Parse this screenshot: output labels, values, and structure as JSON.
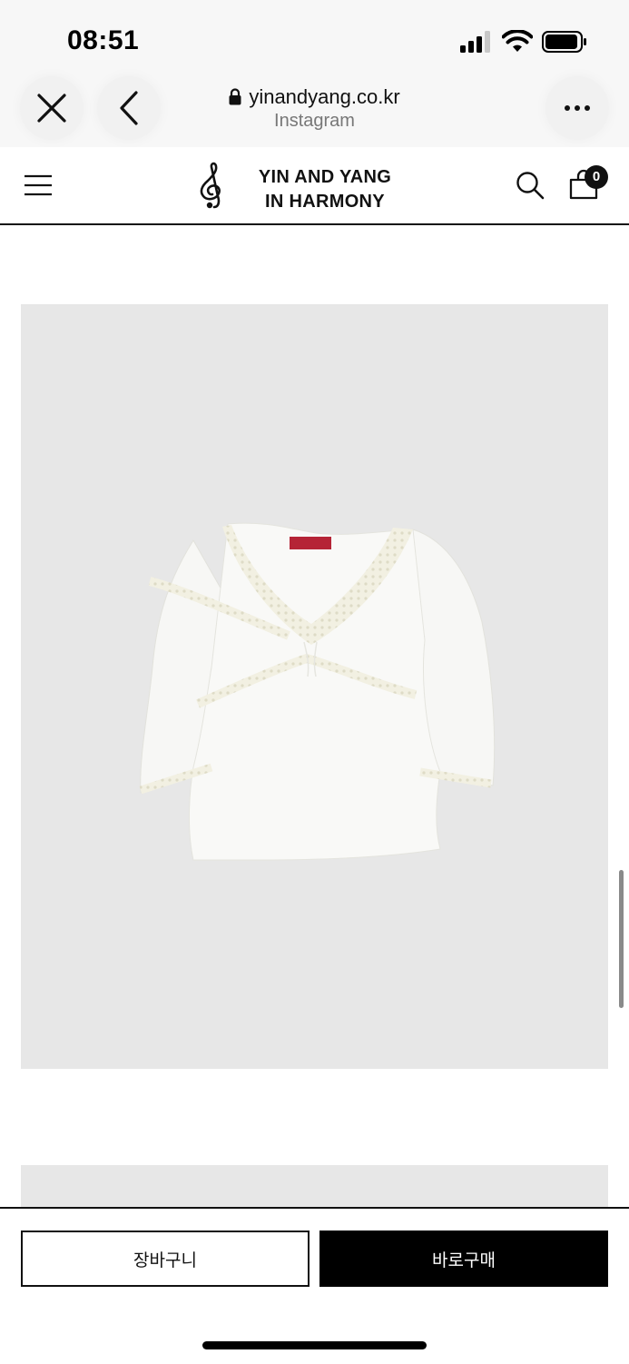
{
  "status_bar": {
    "time": "08:51"
  },
  "browser": {
    "url": "yinandyang.co.kr",
    "source": "Instagram",
    "icons": [
      "close-icon",
      "back-icon",
      "more-icon",
      "lock-icon"
    ]
  },
  "site": {
    "logo_line1": "YIN AND YANG",
    "logo_line2": "IN HARMONY",
    "cart_count": "0",
    "icons": [
      "menu-icon",
      "treble-clef-logo",
      "search-icon",
      "bag-icon"
    ]
  },
  "product": {
    "image_description_icon": "white-lace-trim-long-sleeve-top-image"
  },
  "actions": {
    "cart_label": "장바구니",
    "buy_label": "바로구매"
  },
  "colors": {
    "image_background": "#e7e7e7",
    "buy_button": "#000000",
    "browser_bar": "#f7f7f7"
  }
}
